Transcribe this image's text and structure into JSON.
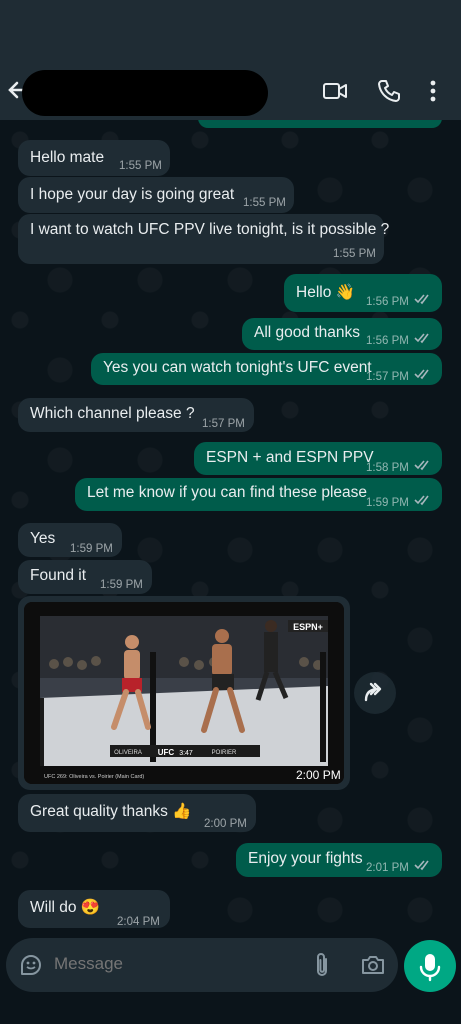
{
  "app": "WhatsApp",
  "composer": {
    "placeholder": "Message"
  },
  "messages": [
    {
      "dir": "in",
      "text": "Hello mate",
      "time": "1:55 PM"
    },
    {
      "dir": "in",
      "text": "I hope your day is going great",
      "time": "1:55 PM"
    },
    {
      "dir": "in",
      "text": "I want to watch UFC PPV live tonight, is it possible ?",
      "time": "1:55 PM"
    },
    {
      "dir": "out",
      "text": "Hello 👋",
      "time": "1:56 PM"
    },
    {
      "dir": "out",
      "text": "All good thanks",
      "time": "1:56 PM"
    },
    {
      "dir": "out",
      "text": "Yes you can watch tonight's UFC event",
      "time": "1:57 PM"
    },
    {
      "dir": "in",
      "text": "Which channel please ?",
      "time": "1:57 PM"
    },
    {
      "dir": "out",
      "text": "ESPN + and ESPN PPV",
      "time": "1:58 PM"
    },
    {
      "dir": "out",
      "text": "Let me know if you can find these please",
      "time": "1:59 PM"
    },
    {
      "dir": "in",
      "text": "Yes",
      "time": "1:59 PM"
    },
    {
      "dir": "in",
      "text": "Found it",
      "time": "1:59 PM"
    },
    {
      "dir": "in",
      "text": "Great quality thanks 👍",
      "time": "2:00 PM"
    },
    {
      "dir": "out",
      "text": "Enjoy your fights",
      "time": "2:01 PM"
    },
    {
      "dir": "in",
      "text": "Will do 😍",
      "time": "2:04 PM"
    }
  ],
  "media": {
    "time": "2:00 PM",
    "caption": "UFC 269: Oliveira vs. Poirier (Main Card)",
    "scoreboard": {
      "left": "OLIVEIRA",
      "center": "UFC",
      "clock": "3:47",
      "right": "POIRIER"
    },
    "network_logo": "ESPN+"
  },
  "icons": {
    "back": "arrow-left-icon",
    "video_call": "video-camera-icon",
    "voice_call": "phone-icon",
    "menu": "more-vertical-icon",
    "sticker": "sticker-icon",
    "attach": "paperclip-icon",
    "camera": "camera-icon",
    "mic": "microphone-icon",
    "forward": "forward-icon"
  },
  "colors": {
    "incoming": "#1f2c34",
    "outgoing": "#005c4b",
    "accent": "#00a884",
    "background": "#0b141a"
  }
}
